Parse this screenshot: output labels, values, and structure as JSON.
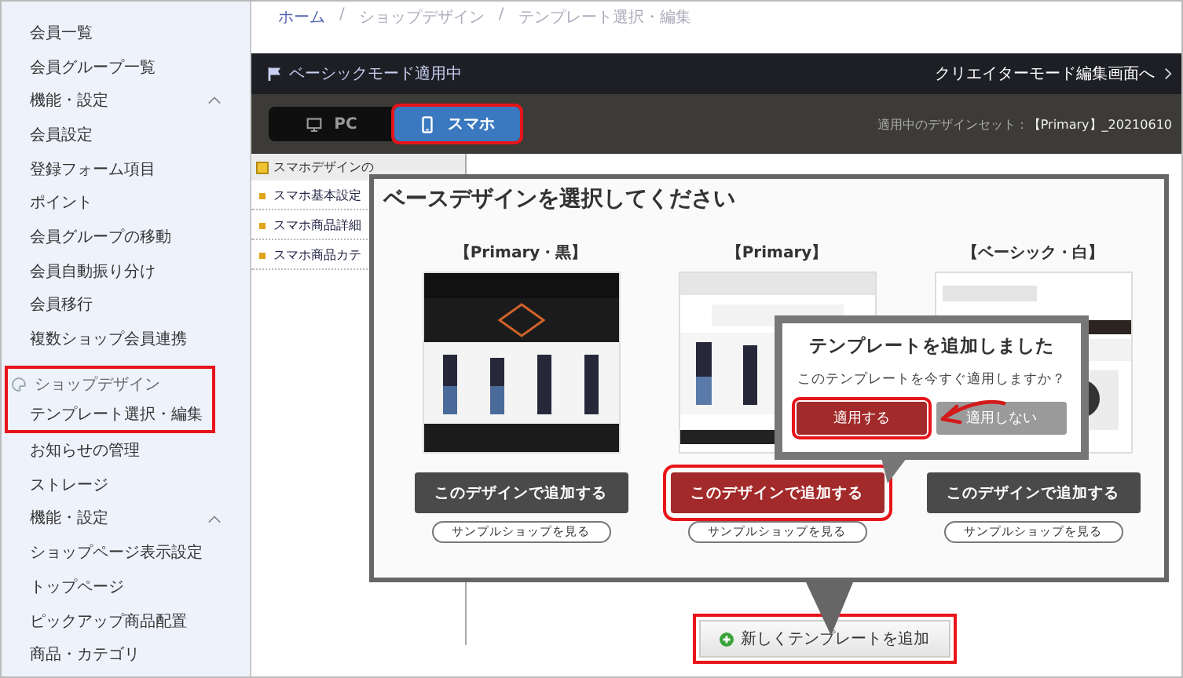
{
  "sidebar": {
    "items": [
      {
        "label": "会員一覧",
        "kind": "link",
        "highlighted": false
      },
      {
        "label": "会員グループ一覧",
        "kind": "link",
        "highlighted": false
      },
      {
        "label": "機能・設定",
        "kind": "group",
        "expanded": true,
        "highlighted": false
      },
      {
        "label": "会員設定",
        "kind": "link",
        "highlighted": false
      },
      {
        "label": "登録フォーム項目",
        "kind": "link",
        "highlighted": false
      },
      {
        "label": "ポイント",
        "kind": "link",
        "highlighted": false
      },
      {
        "label": "会員グループの移動",
        "kind": "link",
        "highlighted": false
      },
      {
        "label": "会員自動振り分け",
        "kind": "link",
        "highlighted": false
      },
      {
        "label": "会員移行",
        "kind": "link",
        "highlighted": false
      },
      {
        "label": "複数ショップ会員連携",
        "kind": "link",
        "highlighted": false
      },
      {
        "label": "ショップデザイン",
        "kind": "section",
        "highlighted": true
      },
      {
        "label": "テンプレート選択・編集",
        "kind": "link",
        "highlighted": true
      },
      {
        "label": "お知らせの管理",
        "kind": "link",
        "highlighted": false
      },
      {
        "label": "ストレージ",
        "kind": "link",
        "highlighted": false
      },
      {
        "label": "機能・設定",
        "kind": "group",
        "expanded": true,
        "highlighted": false
      },
      {
        "label": "ショップページ表示設定",
        "kind": "link",
        "highlighted": false
      },
      {
        "label": "トップページ",
        "kind": "link",
        "highlighted": false
      },
      {
        "label": "ピックアップ商品配置",
        "kind": "link",
        "highlighted": false
      },
      {
        "label": "商品・カテゴリ",
        "kind": "link",
        "highlighted": false
      }
    ]
  },
  "breadcrumb": [
    {
      "label": "ホーム",
      "kind": "link"
    },
    {
      "label": "/",
      "kind": "separator"
    },
    {
      "label": "ショップデザイン",
      "kind": "link"
    },
    {
      "label": "/",
      "kind": "separator"
    },
    {
      "label": "テンプレート選択・編集",
      "kind": "current"
    }
  ],
  "mode_bar": {
    "status": "ベーシックモード適用中",
    "link": "クリエイターモード編集画面へ"
  },
  "device_tabs": [
    {
      "label": "PC",
      "kind": "desktop",
      "selected": false,
      "highlighted": false
    },
    {
      "label": "スマホ",
      "kind": "phone",
      "selected": true,
      "highlighted": true
    }
  ],
  "applied_set": {
    "label": "適用中のデザインセット：",
    "value": "【Primary】_20210610"
  },
  "sub_panel": {
    "header": "スマホデザインの",
    "items": [
      "スマホ基本設定",
      "スマホ商品詳細",
      "スマホ商品カテ"
    ]
  },
  "modal": {
    "title": "ベースデザインを選択してください",
    "templates": [
      {
        "name": "【Primary・黒】",
        "kind": "dark",
        "add": "このデザインで追加する",
        "sample": "サンプルショップを見る",
        "selected": false
      },
      {
        "name": "【Primary】",
        "kind": "light",
        "add": "このデザインで追加する",
        "sample": "サンプルショップを見る",
        "selected": true
      },
      {
        "name": "【ベーシック・白】",
        "kind": "white",
        "add": "このデザインで追加する",
        "sample": "サンプルショップを見る",
        "selected": false
      }
    ]
  },
  "dialog": {
    "title": "テンプレートを追加しました",
    "message": "このテンプレートを今すぐ適用しますか？",
    "buttons": [
      {
        "label": "適用する",
        "kind": "primary",
        "highlighted": true
      },
      {
        "label": "適用しない",
        "kind": "secondary",
        "highlighted": false
      }
    ]
  },
  "add_button": {
    "label": "新しくテンプレートを追加",
    "highlighted": true
  }
}
